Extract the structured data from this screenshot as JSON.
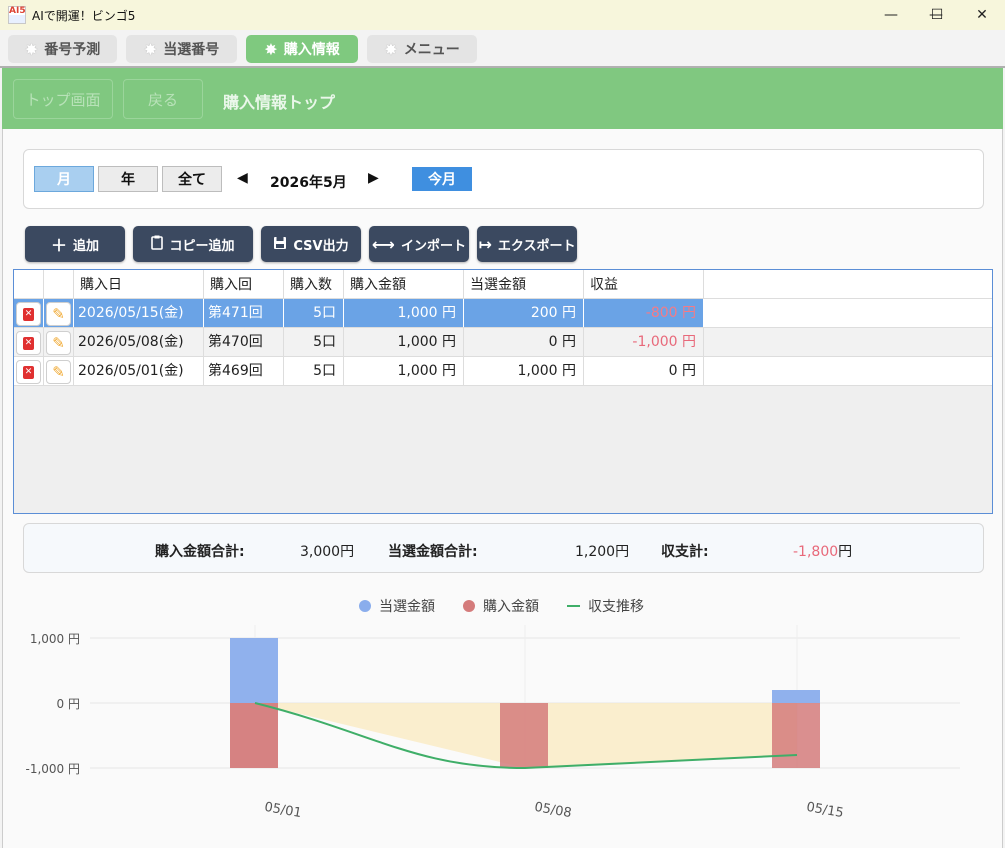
{
  "window": {
    "title": "AIで開運！ビンゴ5",
    "icon_text": "AI5"
  },
  "tabs": [
    {
      "label": "番号予測",
      "active": false
    },
    {
      "label": "当選番号",
      "active": false
    },
    {
      "label": "購入情報",
      "active": true
    },
    {
      "label": "メニュー",
      "active": false
    }
  ],
  "header": {
    "top_button": "トップ画面",
    "back_button": "戻る",
    "title": "購入情報トップ"
  },
  "filter": {
    "period_options": [
      {
        "label": "月",
        "selected": true
      },
      {
        "label": "年",
        "selected": false
      },
      {
        "label": "全て",
        "selected": false
      }
    ],
    "prev": "◀",
    "next": "▶",
    "current": "2026年5月",
    "today_button": "今月"
  },
  "actions": [
    {
      "label": "追加",
      "icon": "plus-icon",
      "glyph": "＋"
    },
    {
      "label": "コピー追加",
      "icon": "clipboard-icon",
      "glyph": "📋"
    },
    {
      "label": "CSV出力",
      "icon": "save-icon",
      "glyph": "🖫"
    },
    {
      "label": "インポート",
      "icon": "import-icon",
      "glyph": "⟷"
    },
    {
      "label": "エクスポート",
      "icon": "export-icon",
      "glyph": "↦"
    }
  ],
  "table": {
    "columns": [
      "購入日",
      "購入回",
      "購入数",
      "購入金額",
      "当選金額",
      "収益"
    ],
    "rows": [
      {
        "date": "2026/05/15(金)",
        "round": "第471回",
        "count": "5口",
        "cost": "1,000 円",
        "win": "200 円",
        "profit": "-800 円",
        "negative": true,
        "selected": true
      },
      {
        "date": "2026/05/08(金)",
        "round": "第470回",
        "count": "5口",
        "cost": "1,000 円",
        "win": "0 円",
        "profit": "-1,000 円",
        "negative": true,
        "selected": false
      },
      {
        "date": "2026/05/01(金)",
        "round": "第469回",
        "count": "5口",
        "cost": "1,000 円",
        "win": "1,000 円",
        "profit": "0 円",
        "negative": false,
        "selected": false
      }
    ]
  },
  "summary": {
    "cost_label": "購入金額合計:",
    "cost_value": "3,000円",
    "win_label": "当選金額合計:",
    "win_value": "1,200円",
    "balance_label": "収支計:",
    "balance_value": "-1,800",
    "balance_unit": "円"
  },
  "colors": {
    "accent_green": "#80c880",
    "win": "#8aadec",
    "cost": "#d47b7b",
    "trend": "#3fae68",
    "fill": "#f9ebc6"
  },
  "chart_data": {
    "type": "bar",
    "categories": [
      "05/01",
      "05/08",
      "05/15"
    ],
    "series": [
      {
        "name": "当選金額",
        "values": [
          1000,
          0,
          200
        ]
      },
      {
        "name": "購入金額",
        "values": [
          -1000,
          -1000,
          -1000
        ]
      },
      {
        "name": "収支推移",
        "type": "line",
        "values": [
          0,
          -1000,
          -800
        ]
      }
    ],
    "y_ticks": [
      "1,000 円",
      "0 円",
      "-1,000 円"
    ],
    "ylim": [
      -1000,
      1000
    ],
    "legend": "top-center"
  }
}
